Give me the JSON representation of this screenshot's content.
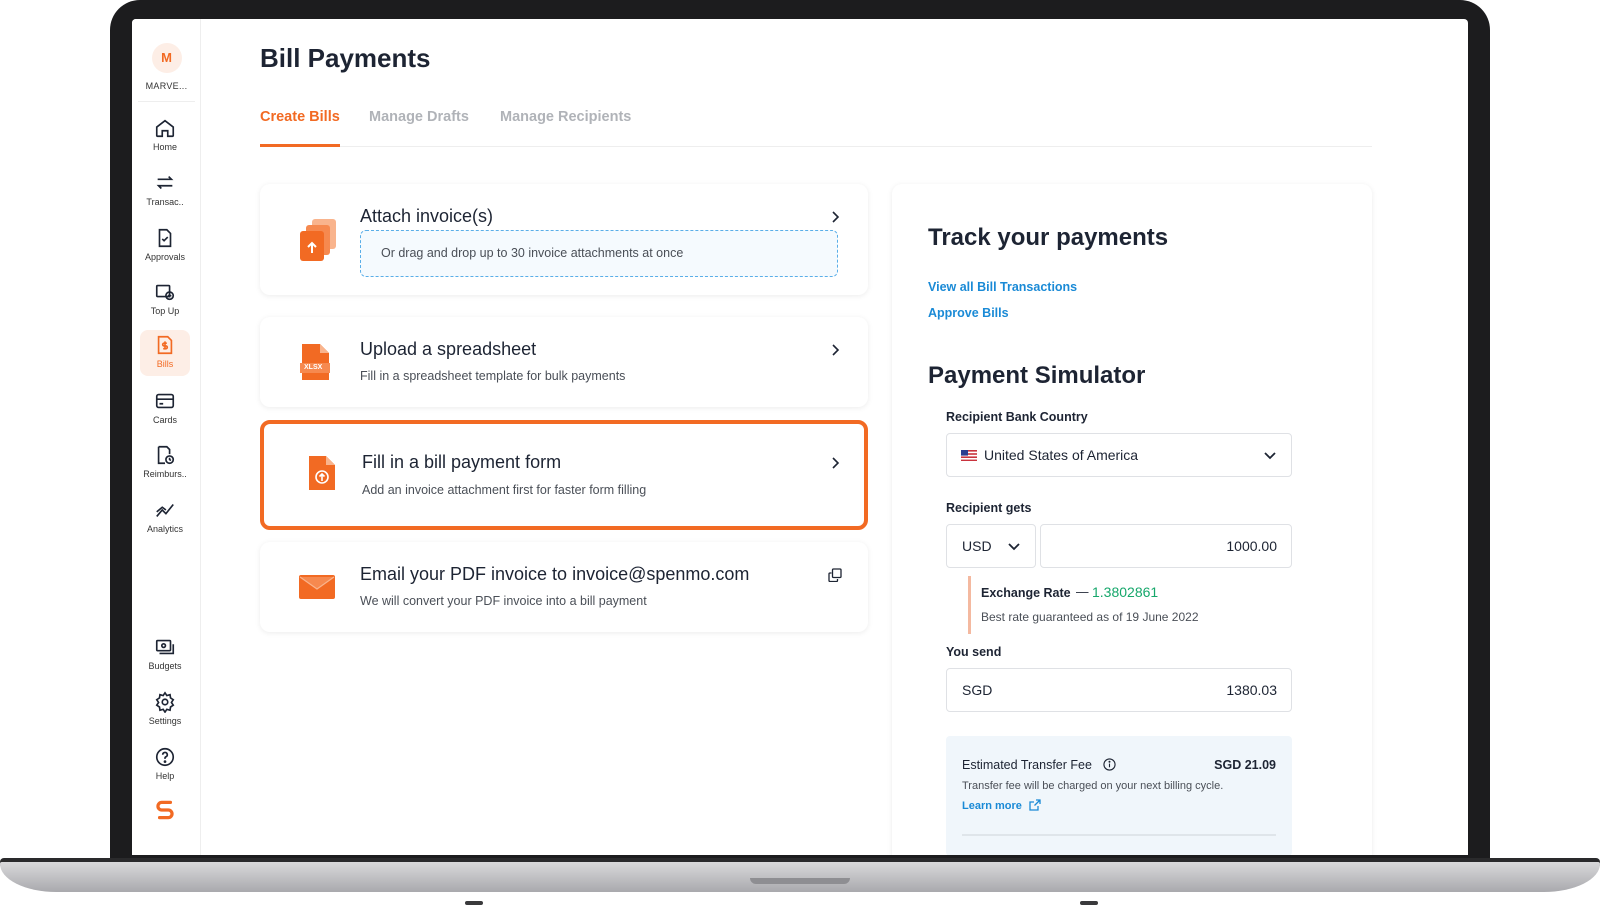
{
  "org": {
    "initial": "M",
    "name": "MARVE..."
  },
  "nav": {
    "items": [
      {
        "label": "Home",
        "icon": "home-icon"
      },
      {
        "label": "Transac..",
        "icon": "transfer-icon"
      },
      {
        "label": "Approvals",
        "icon": "approvals-icon"
      },
      {
        "label": "Top Up",
        "icon": "top-up-icon"
      },
      {
        "label": "Bills",
        "icon": "bills-icon",
        "active": true
      },
      {
        "label": "Cards",
        "icon": "card-icon"
      },
      {
        "label": "Reimburs..",
        "icon": "reimbursement-icon"
      },
      {
        "label": "Analytics",
        "icon": "analytics-icon"
      }
    ],
    "bottom": [
      {
        "label": "Budgets",
        "icon": "budgets-icon"
      },
      {
        "label": "Settings",
        "icon": "gear-icon"
      },
      {
        "label": "Help",
        "icon": "help-icon"
      }
    ]
  },
  "page": {
    "title": "Bill Payments"
  },
  "tabs": [
    {
      "label": "Create Bills",
      "active": true
    },
    {
      "label": "Manage Drafts"
    },
    {
      "label": "Manage Recipients"
    }
  ],
  "options": {
    "attach": {
      "title": "Attach invoice(s)",
      "dropzone": "Or drag and drop up to 30 invoice attachments at once"
    },
    "spreadsheet": {
      "title": "Upload a spreadsheet",
      "subtitle": "Fill in a spreadsheet template for bulk payments",
      "badge": "XLSX"
    },
    "form": {
      "title": "Fill in a bill payment form",
      "subtitle": "Add an invoice attachment first for faster form filling"
    },
    "email": {
      "title": "Email your PDF invoice to invoice@spenmo.com",
      "subtitle": "We will convert your PDF invoice into a bill payment"
    }
  },
  "track": {
    "title": "Track your payments",
    "links": [
      "View all Bill Transactions",
      "Approve Bills"
    ]
  },
  "simulator": {
    "title": "Payment Simulator",
    "country_label": "Recipient Bank Country",
    "country": "United States of America",
    "gets_label": "Recipient gets",
    "gets_currency": "USD",
    "gets_amount": "1000.00",
    "rate_label": "Exchange Rate",
    "rate_dash": "—",
    "rate_value": "1.3802861",
    "rate_note": "Best rate guaranteed as of 19 June 2022",
    "send_label": "You send",
    "send_currency": "SGD",
    "send_amount": "1380.03",
    "fee_label": "Estimated Transfer Fee",
    "fee_value": "SGD 21.09",
    "fee_note": "Transfer fee will be charged on your next billing cycle.",
    "fee_link": "Learn more"
  },
  "colors": {
    "accent": "#f26a23",
    "link": "#1a8ad6",
    "rate": "#16a76b"
  }
}
